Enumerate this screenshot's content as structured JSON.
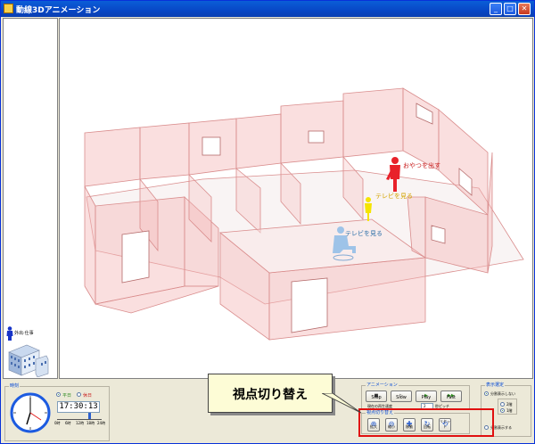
{
  "window": {
    "title": "動線3Dアニメーション",
    "controls": {
      "minimize": "_",
      "maximize": "□",
      "close": "✕"
    }
  },
  "left_panel": {
    "activity_label": "外出·仕事",
    "person_icon": "person-icon",
    "building_icon": "building-icon"
  },
  "view3d": {
    "labels": {
      "red_person": "おやつを出す",
      "yellow_person": "テレビを見る",
      "blue_person": "テレビを見る"
    },
    "colors": {
      "wall": "#f4b7b7",
      "wall_edge": "#d98c8c",
      "red": "#e8212a",
      "yellow": "#f5e400",
      "blue": "#8fbde8"
    }
  },
  "clock_group": {
    "title": "時刻",
    "day_type": {
      "weekday": "平日",
      "holiday": "休日",
      "selected": "weekday"
    },
    "time": "17:30:13",
    "ticks": [
      "0時",
      "6時",
      "12時",
      "18時",
      "24時"
    ]
  },
  "animation_group": {
    "title": "アニメーション",
    "buttons": [
      {
        "label": "Stop",
        "icon": "■"
      },
      {
        "label": "Slow",
        "icon": "▷"
      },
      {
        "label": "Play",
        "icon": "▶"
      },
      {
        "label": "Fast",
        "icon": "▶▶"
      }
    ],
    "speed_label": "現在の再生速度",
    "speed_value": "2",
    "speed_unit": "秒ピッチ"
  },
  "viewpoint_group": {
    "title": "視点切り替え",
    "buttons": [
      {
        "label": "拡大",
        "icon": "⊕"
      },
      {
        "label": "縮小",
        "icon": "⊖"
      },
      {
        "label": "移動",
        "icon": "✚"
      },
      {
        "label": "回転",
        "icon": "↻"
      },
      {
        "label": "リセット",
        "icon": "⟲"
      }
    ]
  },
  "display_group": {
    "title": "表示選定",
    "split_none": "分割表示しない",
    "floor2": "2階",
    "floor1": "1階",
    "split_on": "分割表示する"
  },
  "callout": {
    "text": "視点切り替え"
  }
}
